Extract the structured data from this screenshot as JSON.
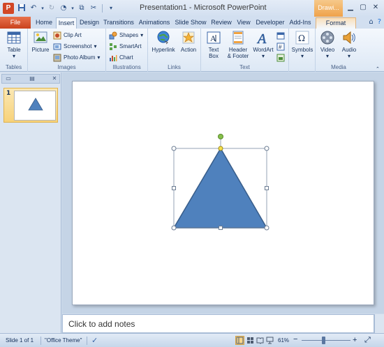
{
  "titlebar": {
    "app_icon_letter": "P",
    "title": "Presentation1 - Microsoft PowerPoint",
    "context_header": "Drawi...",
    "qat": [
      "save-icon",
      "undo-icon",
      "redo-icon",
      "repeat-icon",
      "cut-icon",
      "copy-icon",
      "customize-icon"
    ],
    "window_buttons": [
      "minimize-icon",
      "maximize-icon",
      "close-icon"
    ]
  },
  "tabs": {
    "file": "File",
    "items": [
      "Home",
      "Insert",
      "Design",
      "Transitions",
      "Animations",
      "Slide Show",
      "Review",
      "View",
      "Developer",
      "Add-Ins"
    ],
    "active": "Insert",
    "format": "Format"
  },
  "ribbon": {
    "groups": {
      "tables": "Tables",
      "images": "Images",
      "illustrations": "Illustrations",
      "links": "Links",
      "text": "Text",
      "media": "Media"
    },
    "buttons": {
      "table": "Table",
      "picture": "Picture",
      "clip_art": "Clip Art",
      "screenshot": "Screenshot",
      "photo_album": "Photo Album",
      "shapes": "Shapes",
      "smartart": "SmartArt",
      "chart": "Chart",
      "hyperlink": "Hyperlink",
      "action": "Action",
      "text_box_1": "Text",
      "text_box_2": "Box",
      "header_footer_1": "Header",
      "header_footer_2": "& Footer",
      "wordart": "WordArt",
      "symbols": "Symbols",
      "video": "Video",
      "audio": "Audio"
    },
    "dropdown_arrow": "▾"
  },
  "left_pane": {
    "slide_number": "1"
  },
  "notes": {
    "placeholder": "Click to add notes"
  },
  "status": {
    "slide": "Slide 1 of 1",
    "theme": "\"Office Theme\"",
    "zoom": "61%",
    "zoom_out": "−",
    "zoom_in": "+",
    "zoom_fraction": 0.44
  },
  "colors": {
    "shape_fill": "#4f81bd",
    "shape_outline": "#385d8a",
    "rotate_handle": "#86c04a",
    "adjust_handle": "#f6e04a"
  }
}
